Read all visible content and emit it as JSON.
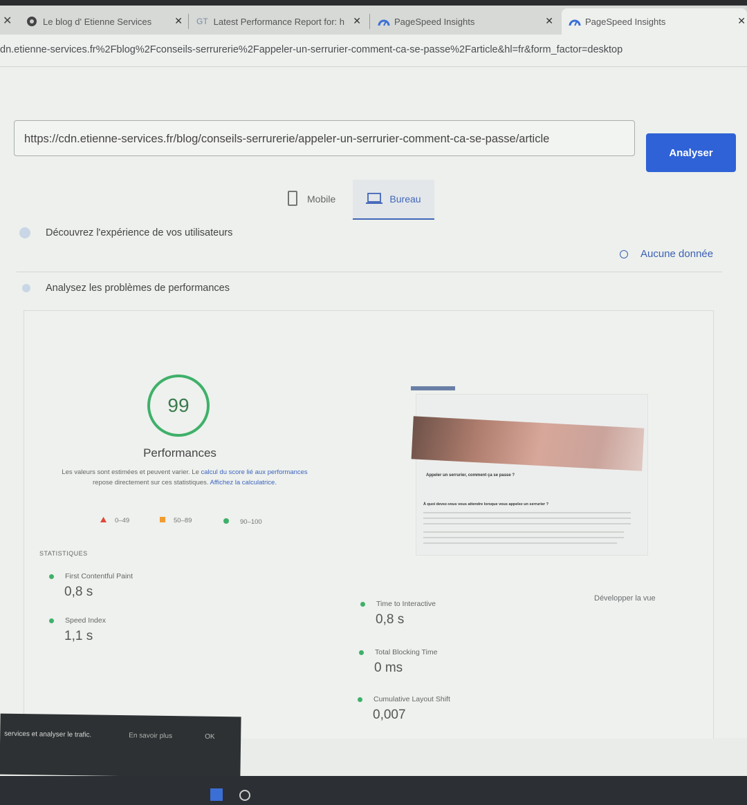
{
  "browser": {
    "tabs": [
      {
        "title": "Le blog d' Etienne Services"
      },
      {
        "title": "Latest Performance Report for: h"
      },
      {
        "title": "PageSpeed Insights"
      },
      {
        "title": "PageSpeed Insights"
      }
    ],
    "tab2_favicon_text": "GT",
    "url": "dn.etienne-services.fr%2Fblog%2Fconseils-serrurerie%2Fappeler-un-serrurier-comment-ca-se-passe%2Farticle&hl=fr&form_factor=desktop"
  },
  "search": {
    "value": "https://cdn.etienne-services.fr/blog/conseils-serrurerie/appeler-un-serrurier-comment-ca-se-passe/article",
    "button_label": "Analyser"
  },
  "device_tabs": [
    {
      "label": "Mobile"
    },
    {
      "label": "Bureau",
      "selected": true
    }
  ],
  "field_data": {
    "title": "Découvrez l'expérience de vos utilisateurs",
    "status": "Aucune donnée"
  },
  "lab": {
    "title": "Analysez les problèmes de performances",
    "score": "99",
    "score_label": "Performances",
    "note_part1": "Les valeurs sont estimées et peuvent varier. Le ",
    "note_link1": "calcul du score lié aux performances",
    "note_part2": " repose directement sur ces statistiques. ",
    "note_link2": "Affichez la calculatrice.",
    "legend": [
      {
        "range": "0–49",
        "color": "#e0463a"
      },
      {
        "range": "50–89",
        "color": "#f29b30"
      },
      {
        "range": "90–100",
        "color": "#3fb06a"
      }
    ],
    "stats_heading": "STATISTIQUES",
    "expand_label": "Développer la vue",
    "metrics": [
      {
        "label": "First Contentful Paint",
        "value": "0,8 s"
      },
      {
        "label": "Speed Index",
        "value": "1,1 s"
      },
      {
        "label": "Time to Interactive",
        "value": "0,8 s"
      },
      {
        "label": "Total Blocking Time",
        "value": "0 ms"
      },
      {
        "label": "Cumulative Layout Shift",
        "value": "0,007"
      }
    ],
    "preview": {
      "heading": "Appeler un serrurier, comment ça se passe ?",
      "subheading": "À quoi devez-vous vous attendre lorsque vous appelez un serrurier ?"
    }
  },
  "cookie_banner": {
    "text": "services et analyser le trafic.",
    "more": "En savoir plus",
    "ok": "OK"
  },
  "colors": {
    "accent": "#2f62d6",
    "good": "#3fb06a",
    "link": "#3b5fb5"
  }
}
